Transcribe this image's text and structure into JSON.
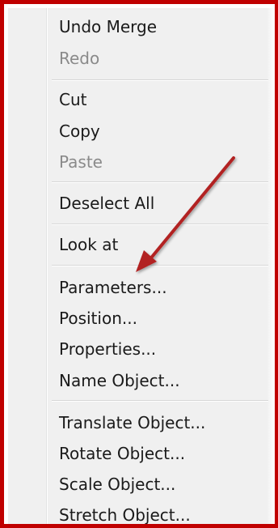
{
  "menu": {
    "items": [
      {
        "label": "Undo Merge",
        "enabled": true
      },
      {
        "label": "Redo",
        "enabled": false
      },
      {
        "label": "Cut",
        "enabled": true
      },
      {
        "label": "Copy",
        "enabled": true
      },
      {
        "label": "Paste",
        "enabled": false
      },
      {
        "label": "Deselect All",
        "enabled": true
      },
      {
        "label": "Look at",
        "enabled": true
      },
      {
        "label": "Parameters...",
        "enabled": true
      },
      {
        "label": "Position...",
        "enabled": true
      },
      {
        "label": "Properties...",
        "enabled": true
      },
      {
        "label": "Name Object...",
        "enabled": true
      },
      {
        "label": "Translate Object...",
        "enabled": true
      },
      {
        "label": "Rotate Object...",
        "enabled": true
      },
      {
        "label": "Scale Object...",
        "enabled": true
      },
      {
        "label": "Stretch Object...",
        "enabled": true
      }
    ]
  },
  "colors": {
    "frame_border": "#c00000",
    "arrow": "#b22222",
    "menu_background": "#f0f0f0",
    "disabled_text": "#8a8a8a"
  },
  "annotation": {
    "arrow_target": "Parameters..."
  }
}
